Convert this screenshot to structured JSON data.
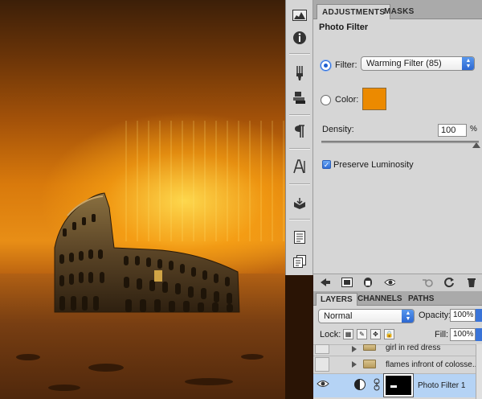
{
  "adjustments": {
    "tabs": [
      {
        "label": "ADJUSTMENTS"
      },
      {
        "label": "MASKS"
      }
    ],
    "title": "Photo Filter",
    "filter_label": "Filter:",
    "filter_value": "Warming Filter (85)",
    "color_label": "Color:",
    "color_value": "#ec8a00",
    "density_label": "Density:",
    "density_value": "100",
    "density_unit": "%",
    "preserve_label": "Preserve Luminosity",
    "preserve_checked": true
  },
  "layers": {
    "tabs": [
      {
        "label": "LAYERS"
      },
      {
        "label": "CHANNELS"
      },
      {
        "label": "PATHS"
      }
    ],
    "blend_mode": "Normal",
    "opacity_label": "Opacity:",
    "opacity_value": "100%",
    "lock_label": "Lock:",
    "fill_label": "Fill:",
    "fill_value": "100%",
    "items": [
      {
        "name": "girl in red dress"
      },
      {
        "name": "flames infront of colosse..."
      },
      {
        "name": "Photo Filter 1"
      }
    ]
  },
  "dock": {
    "icons": [
      "histogram-icon",
      "info-icon",
      "brush-presets-icon",
      "clone-source-icon",
      "paragraph-icon",
      "character-icon",
      "actions-icon",
      "notes-icon",
      "layer-comps-icon"
    ]
  }
}
